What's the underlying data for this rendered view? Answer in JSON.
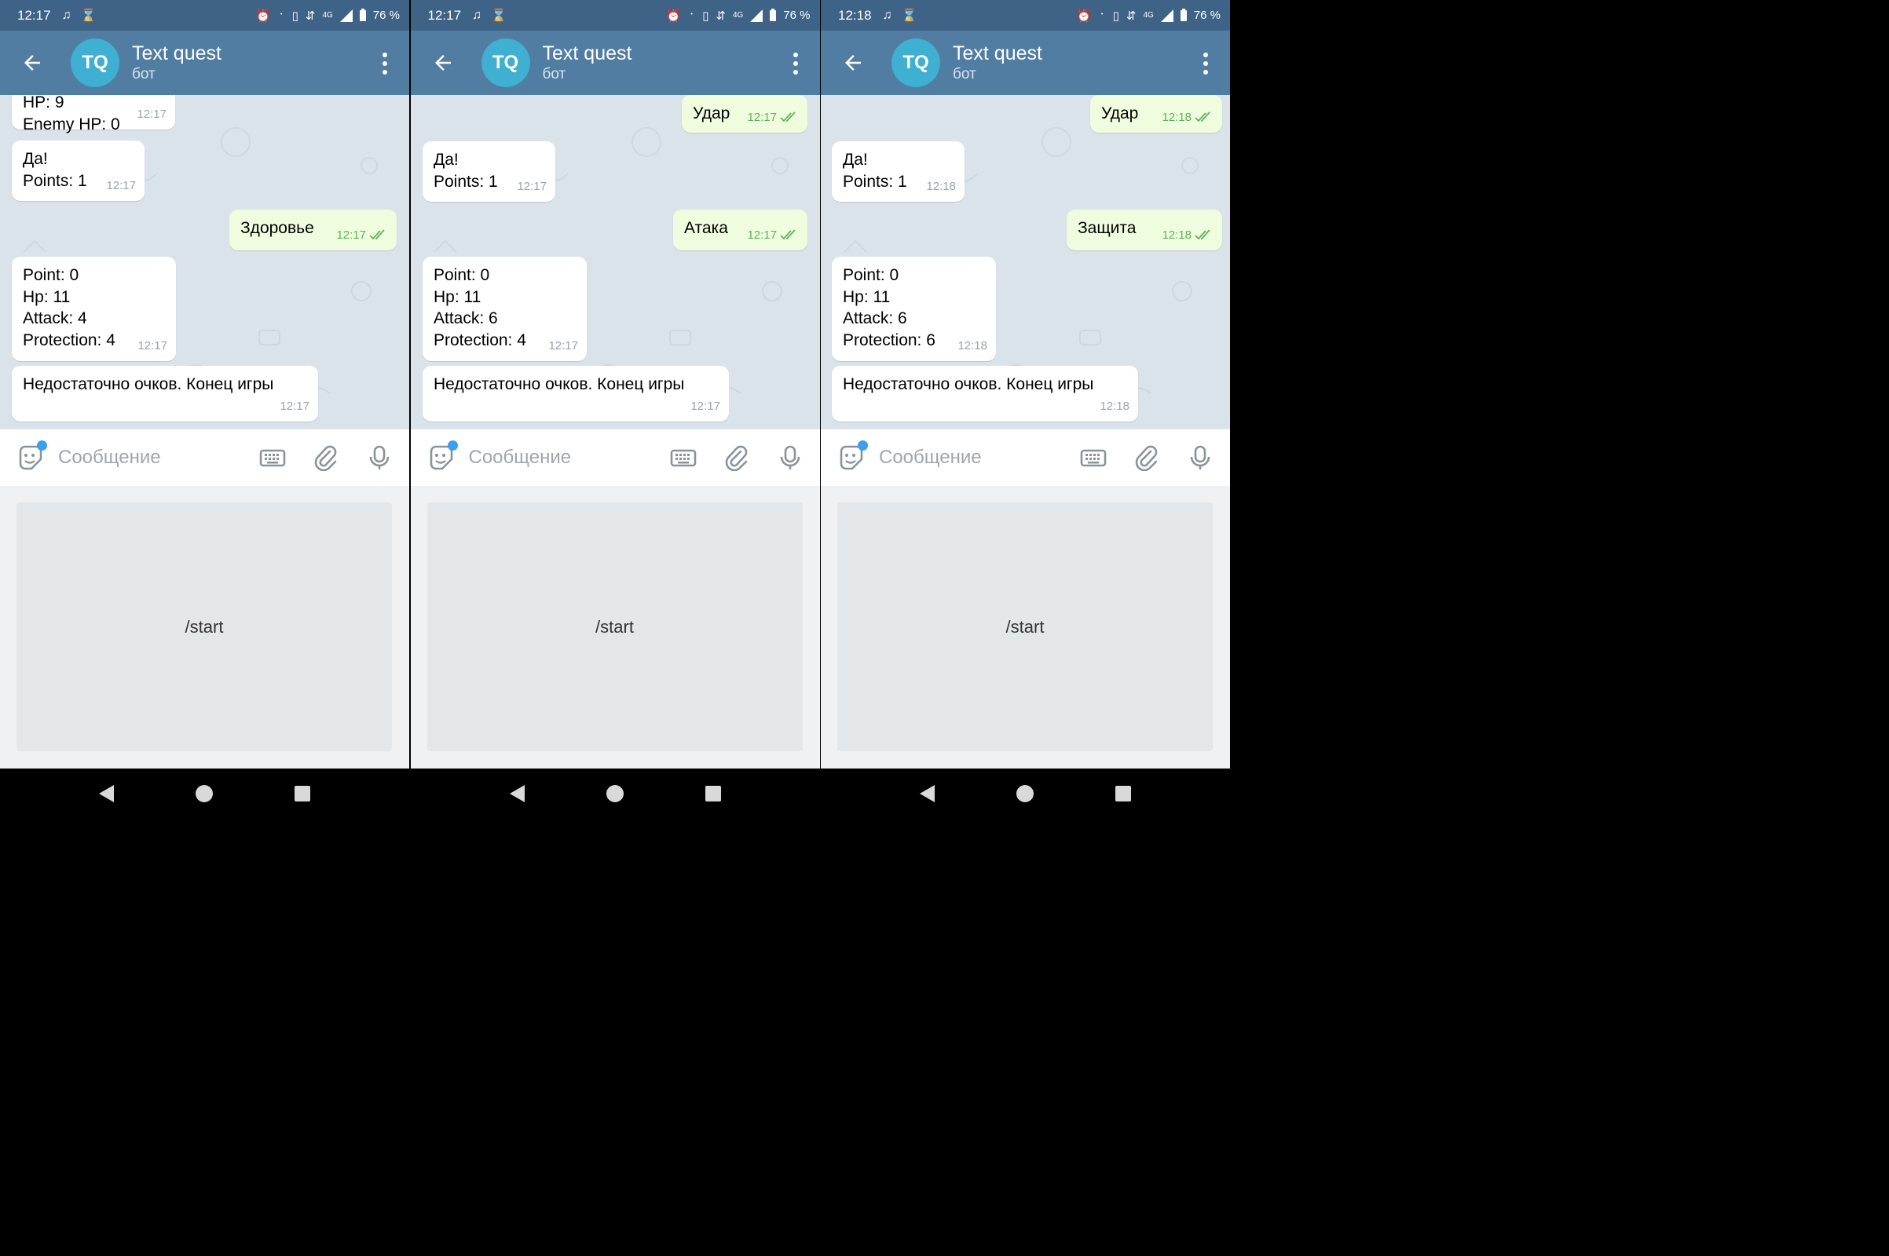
{
  "screens": [
    {
      "status_time": "12:17",
      "battery": "76 %",
      "network": "4G",
      "chat_title": "Text quest",
      "chat_subtitle": "бот",
      "avatar_initials": "TQ",
      "input_placeholder": "Сообщение",
      "keyboard_button": "/start",
      "messages": [
        {
          "dir": "in",
          "text": "HP: 9\nEnemy HP: 0",
          "time": "12:17"
        },
        {
          "dir": "in",
          "text": "Да!\nPoints: 1",
          "time": "12:17"
        },
        {
          "dir": "out",
          "text": "Здоровье",
          "time": "12:17"
        },
        {
          "dir": "in",
          "text": "Point: 0\nHp: 11\nAttack: 4\nProtection: 4",
          "time": "12:17"
        },
        {
          "dir": "in",
          "text": "Недостаточно очков. Конец игры",
          "time": "12:17"
        }
      ]
    },
    {
      "status_time": "12:17",
      "battery": "76 %",
      "network": "4G",
      "chat_title": "Text quest",
      "chat_subtitle": "бот",
      "avatar_initials": "TQ",
      "input_placeholder": "Сообщение",
      "keyboard_button": "/start",
      "messages": [
        {
          "dir": "out",
          "text": "Удар",
          "time": "12:17"
        },
        {
          "dir": "in",
          "text": "Да!\nPoints: 1",
          "time": "12:17"
        },
        {
          "dir": "out",
          "text": "Атака",
          "time": "12:17"
        },
        {
          "dir": "in",
          "text": "Point: 0\nHp: 11\nAttack: 6\nProtection: 4",
          "time": "12:17"
        },
        {
          "dir": "in",
          "text": "Недостаточно очков. Конец игры",
          "time": "12:17"
        }
      ]
    },
    {
      "status_time": "12:18",
      "battery": "76 %",
      "network": "4G",
      "chat_title": "Text quest",
      "chat_subtitle": "бот",
      "avatar_initials": "TQ",
      "input_placeholder": "Сообщение",
      "keyboard_button": "/start",
      "messages": [
        {
          "dir": "out",
          "text": "Удар",
          "time": "12:18"
        },
        {
          "dir": "in",
          "text": "Да!\nPoints: 1",
          "time": "12:18"
        },
        {
          "dir": "out",
          "text": "Защита",
          "time": "12:18"
        },
        {
          "dir": "in",
          "text": "Point: 0\nHp: 11\nAttack: 6\nProtection: 6",
          "time": "12:18"
        },
        {
          "dir": "in",
          "text": "Недостаточно очков. Конец игры",
          "time": "12:18"
        }
      ]
    }
  ],
  "colors": {
    "statusbar": "#3f6387",
    "header": "#517da2",
    "avatar": "#3fb0d1",
    "chat_bg": "#dbe3ea",
    "outgoing_bubble": "#effdde",
    "incoming_bubble": "#ffffff",
    "read_checks": "#5fb25a",
    "emoji_dot": "#3c9ef0"
  },
  "icons": {
    "status_left": [
      "tiktok-icon",
      "hourglass-icon"
    ],
    "status_right": [
      "alarm-icon",
      "bluetooth-icon",
      "vibrate-icon",
      "data-arrows-icon",
      "signal-icon",
      "battery-icon"
    ],
    "header": [
      "back-arrow-icon",
      "more-vert-icon"
    ],
    "input": [
      "emoji-sticker-icon",
      "bot-keyboard-icon",
      "paperclip-icon",
      "microphone-icon"
    ],
    "nav": [
      "nav-back-icon",
      "nav-home-icon",
      "nav-recents-icon"
    ]
  }
}
